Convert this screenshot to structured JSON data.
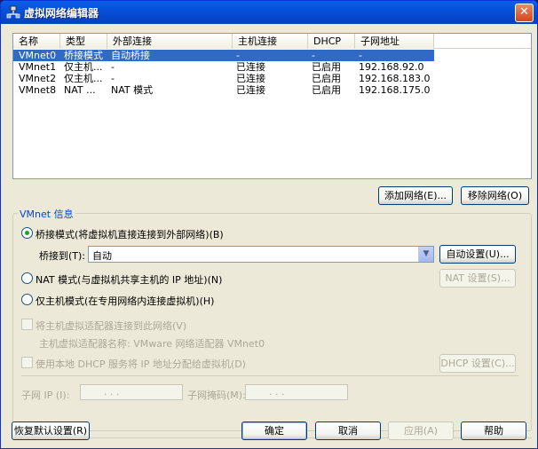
{
  "window": {
    "title": "虚拟网络编辑器",
    "close_label": "✕"
  },
  "list": {
    "columns": [
      "名称",
      "类型",
      "外部连接",
      "主机连接",
      "DHCP",
      "子网地址"
    ],
    "rows": [
      {
        "name": "VMnet0",
        "type": "桥接模式",
        "external": "自动桥接",
        "host": "-",
        "dhcp": "-",
        "subnet": "-",
        "selected": true
      },
      {
        "name": "VMnet1",
        "type": "仅主机...",
        "external": "-",
        "host": "已连接",
        "dhcp": "已启用",
        "subnet": "192.168.92.0"
      },
      {
        "name": "VMnet2",
        "type": "仅主机...",
        "external": "-",
        "host": "已连接",
        "dhcp": "已启用",
        "subnet": "192.168.183.0"
      },
      {
        "name": "VMnet8",
        "type": "NAT ...",
        "external": "NAT 模式",
        "host": "已连接",
        "dhcp": "已启用",
        "subnet": "192.168.175.0"
      }
    ]
  },
  "list_buttons": {
    "add": "添加网络(E)...",
    "remove": "移除网络(O)"
  },
  "info": {
    "title": "VMnet 信息",
    "bridge_radio": "桥接模式(将虚拟机直接连接到外部网络)(B)",
    "bridge_to_label": "桥接到(T):",
    "bridge_to_value": "自动",
    "auto_settings": "自动设置(U)...",
    "nat_radio": "NAT 模式(与虚拟机共享主机的 IP 地址)(N)",
    "nat_settings": "NAT 设置(S)...",
    "hostonly_radio": "仅主机模式(在专用网络内连接虚拟机)(H)",
    "connect_adapter": "将主机虚拟适配器连接到此网络(V)",
    "adapter_name": "主机虚拟适配器名称: VMware 网络适配器 VMnet0",
    "use_dhcp": "使用本地 DHCP 服务将 IP 地址分配给虚拟机(D)",
    "dhcp_settings": "DHCP 设置(C)...",
    "subnet_ip_label": "子网 IP (I):",
    "subnet_mask_label": "子网掩码(M):",
    "ip_placeholder": ".     .     ."
  },
  "bottom_buttons": {
    "restore": "恢复默认设置(R)",
    "ok": "确定",
    "cancel": "取消",
    "apply": "应用(A)",
    "help": "帮助"
  }
}
